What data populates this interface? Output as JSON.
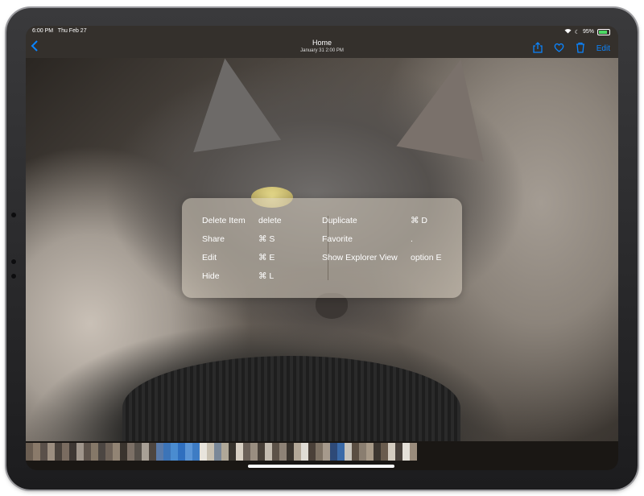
{
  "status_bar": {
    "time": "6:00 PM",
    "date": "Thu Feb 27",
    "battery": "95%"
  },
  "nav": {
    "title": "Home",
    "subtitle": "January 31  2:00 PM",
    "edit_label": "Edit"
  },
  "icons": {
    "back": "chevron-left-icon",
    "share": "share-icon",
    "favorite": "heart-icon",
    "delete": "trash-icon",
    "wifi": "wifi-icon",
    "moon": "moon-icon",
    "battery": "battery-icon"
  },
  "colors": {
    "accent": "#0a84ff",
    "battery_fill": "#4cd964"
  },
  "shortcuts": {
    "left": [
      {
        "label": "Delete Item",
        "keys": "delete"
      },
      {
        "label": "Share",
        "keys": "⌘ S"
      },
      {
        "label": "Edit",
        "keys": "⌘ E"
      },
      {
        "label": "Hide",
        "keys": "⌘ L"
      }
    ],
    "right": [
      {
        "label": "Duplicate",
        "keys": "⌘ D"
      },
      {
        "label": "Favorite",
        "keys": "."
      },
      {
        "label": "Show Explorer View",
        "keys": "option E"
      }
    ]
  },
  "filmstrip": {
    "thumbnail_colors": [
      "#6b5e52",
      "#8a7a6a",
      "#5a504a",
      "#9c8e80",
      "#4a423c",
      "#7a6c60",
      "#3e3834",
      "#a0968c",
      "#5e544c",
      "#857868",
      "#4c4642",
      "#6e6258",
      "#928474",
      "#3a342e",
      "#7c7066",
      "#56504a",
      "#a8a096",
      "#4e4640",
      "#5a7aa8",
      "#3c74b8",
      "#4a8cd0",
      "#2f6fbf",
      "#5b95d6",
      "#3e7cc4",
      "#e8e4dc",
      "#c8c0b0",
      "#7a8898",
      "#b0a898",
      "#38342e",
      "#d8d0c4",
      "#6a6058",
      "#9a8e80",
      "#484038",
      "#c4bcb0",
      "#5c5248",
      "#8e8276",
      "#3a342e",
      "#b4a898",
      "#e0dcd4",
      "#4a4038",
      "#7e7264",
      "#a69a8c",
      "#2e4a78",
      "#3a6aa8",
      "#c8c4bc",
      "#5a4e42",
      "#8a7e70",
      "#a89a88",
      "#3c3630",
      "#6a5c4e",
      "#d4ccc0",
      "#48403a",
      "#e4e0d8",
      "#9a8c7c"
    ]
  }
}
